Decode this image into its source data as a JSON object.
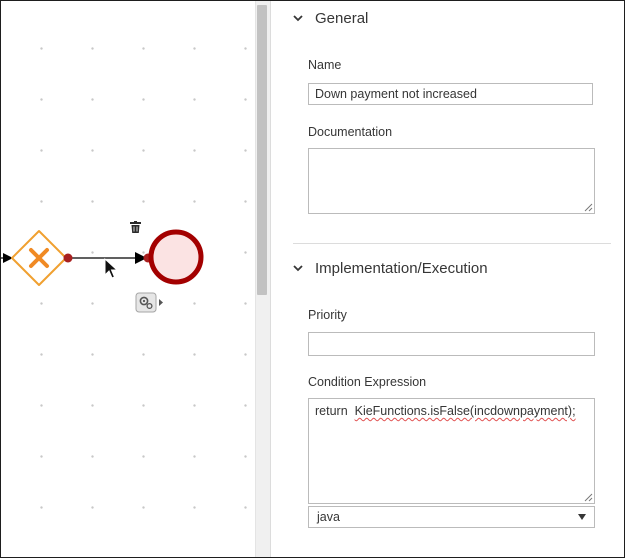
{
  "canvas": {
    "icons": {
      "trash": "trash-icon",
      "gateway": "exclusive-gateway-icon",
      "end_event": "end-event-icon",
      "cursor": "mouse-cursor-icon",
      "settings": "gears-icon"
    },
    "colors": {
      "gateway_stroke": "#f0a030",
      "gateway_x": "#f08a24",
      "end_event_stroke": "#a30000",
      "end_event_fill": "#fbe3e3",
      "connector_dot": "#a82020"
    }
  },
  "panel": {
    "general": {
      "title": "General",
      "name_label": "Name",
      "name_value": "Down payment not increased",
      "documentation_label": "Documentation",
      "documentation_value": ""
    },
    "implementation": {
      "title": "Implementation/Execution",
      "priority_label": "Priority",
      "priority_value": "",
      "condition_label": "Condition Expression",
      "condition_keyword": "return",
      "condition_code": "KieFunctions.isFalse(incdownpayment);",
      "language_value": "java"
    }
  }
}
